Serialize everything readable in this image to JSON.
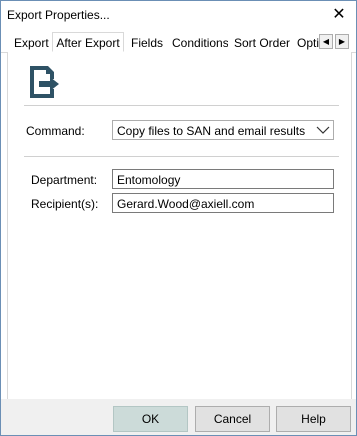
{
  "window": {
    "title": "Export Properties...",
    "close_glyph": "✕"
  },
  "tabs": [
    {
      "label": "Export"
    },
    {
      "label": "After Export"
    },
    {
      "label": "Fields"
    },
    {
      "label": "Conditions"
    },
    {
      "label": "Sort Order"
    },
    {
      "label": "Opti"
    }
  ],
  "tab_scroll": {
    "left_glyph": "◀",
    "right_glyph": "▶"
  },
  "command": {
    "label": "Command:",
    "value": "Copy files to SAN and email results"
  },
  "department": {
    "label": "Department:",
    "value": "Entomology"
  },
  "recipients": {
    "label": "Recipient(s):",
    "value": "Gerard.Wood@axiell.com"
  },
  "buttons": {
    "ok": "OK",
    "cancel": "Cancel",
    "help": "Help"
  },
  "colors": {
    "icon": "#2e5265",
    "ok_button": "#ccdbd9",
    "footer": "#f0f0f0"
  }
}
